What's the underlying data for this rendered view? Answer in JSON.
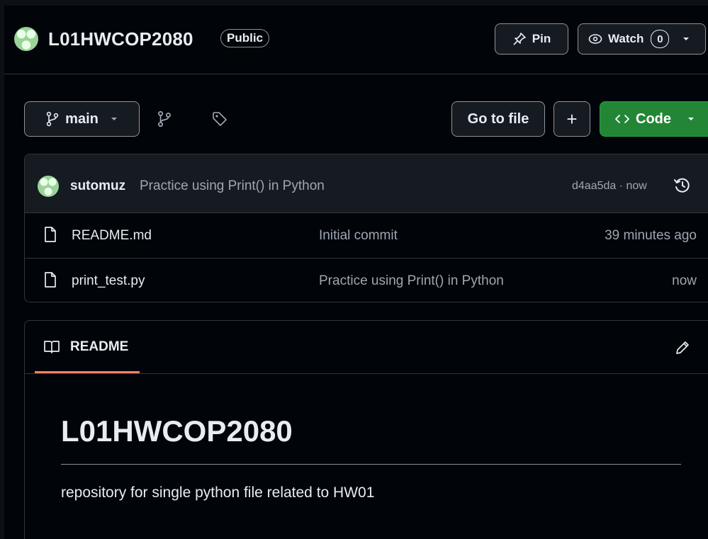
{
  "repo": {
    "name": "L01HWCOP2080",
    "visibility": "Public"
  },
  "header_actions": {
    "pin_label": "Pin",
    "watch_label": "Watch",
    "watch_count": "0"
  },
  "toolbar": {
    "branch": "main",
    "go_to_file": "Go to file",
    "add": "+",
    "code_label": "Code"
  },
  "latest_commit": {
    "author": "sutomuz",
    "message": "Practice using Print() in Python",
    "hash_time": "d4aa5da · now"
  },
  "files": [
    {
      "name": "README.md",
      "message": "Initial commit",
      "time": "39 minutes ago"
    },
    {
      "name": "print_test.py",
      "message": "Practice using Print() in Python",
      "time": "now"
    }
  ],
  "readme": {
    "tab_label": "README",
    "heading": "L01HWCOP2080",
    "description": "repository for single python file related to HW01"
  },
  "icons": {
    "pin": "pin-icon",
    "watch": "eye-icon",
    "branch": "git-branch-icon",
    "tag": "tag-icon",
    "code": "code-brackets-icon",
    "history": "history-icon",
    "file": "file-icon",
    "book": "book-icon",
    "edit": "pencil-icon"
  },
  "colors": {
    "background": "#010409",
    "panel": "#161b22",
    "border": "#30363d",
    "code_button": "#238636",
    "readme_tab_underline": "#f78166"
  }
}
